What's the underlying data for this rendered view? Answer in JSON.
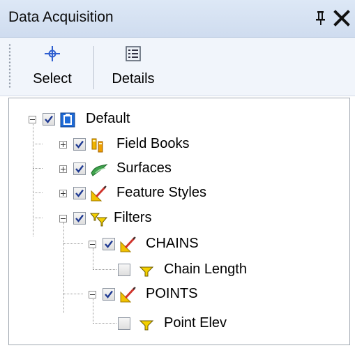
{
  "window": {
    "title": "Data Acquisition"
  },
  "toolbar": {
    "select_label": "Select",
    "details_label": "Details"
  },
  "tree": {
    "root": {
      "label": "Default",
      "checked": true,
      "expanded": true,
      "icon": "database-icon"
    },
    "children": [
      {
        "label": "Field Books",
        "checked": true,
        "expanded": false,
        "icon": "field-books-icon"
      },
      {
        "label": "Surfaces",
        "checked": true,
        "expanded": false,
        "icon": "surfaces-icon"
      },
      {
        "label": "Feature Styles",
        "checked": true,
        "expanded": false,
        "icon": "feature-styles-icon"
      },
      {
        "label": "Filters",
        "checked": true,
        "expanded": true,
        "icon": "filter-icon",
        "children": [
          {
            "label": "CHAINS",
            "checked": true,
            "expanded": true,
            "icon": "feature-styles-icon",
            "children": [
              {
                "label": "Chain Length",
                "checked": false,
                "icon": "filter-icon"
              }
            ]
          },
          {
            "label": "POINTS",
            "checked": true,
            "expanded": true,
            "icon": "feature-styles-icon",
            "children": [
              {
                "label": "Point Elev",
                "checked": false,
                "icon": "filter-icon"
              }
            ]
          }
        ]
      }
    ]
  },
  "colors": {
    "titlebar": "#d6e2f3",
    "toolbar": "#f1f5fb",
    "check": "#1f3a93",
    "filter_yellow": "#f4d000",
    "surface_green": "#3fa34d"
  }
}
